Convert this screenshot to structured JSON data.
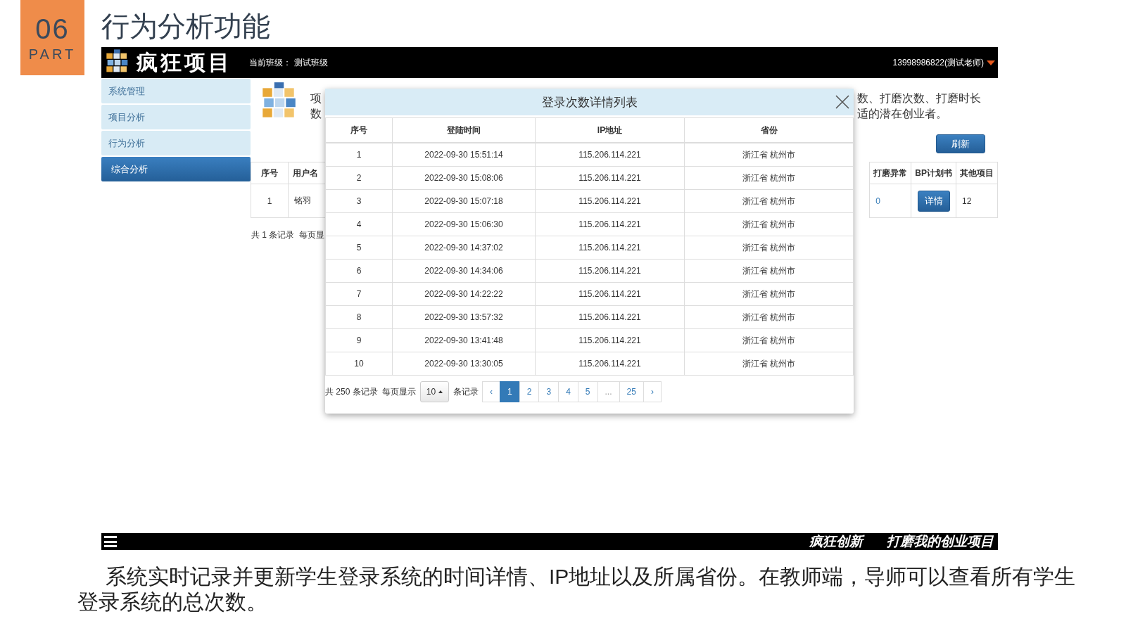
{
  "slide": {
    "part_number": "06",
    "part_label": "PART",
    "title": "行为分析功能"
  },
  "app": {
    "logo_text": "疯狂项目",
    "class_label": "当前班级：",
    "class_name": "测试班级",
    "user": "13998986822(测试老师)",
    "sidebar": [
      {
        "label": "系统管理",
        "selected": false
      },
      {
        "label": "项目分析",
        "selected": false
      },
      {
        "label": "行为分析",
        "selected": false
      },
      {
        "label": "综合分析",
        "selected": true
      }
    ],
    "intro_left": [
      "项",
      "数"
    ],
    "intro_right": [
      "数、打磨次数、打磨时长",
      "适的潜在创业者。"
    ],
    "refresh_button": "刷新",
    "table_left": {
      "columns": [
        "序号",
        "用户名"
      ],
      "rows": [
        [
          {
            "kind": "text",
            "text": "1"
          },
          {
            "kind": "text",
            "text": "铭羽"
          }
        ]
      ]
    },
    "table_right": {
      "columns": [
        "打磨异常",
        "BP计划书",
        "其他项目"
      ],
      "rows": [
        [
          {
            "kind": "link",
            "text": "0"
          },
          {
            "kind": "button",
            "text": "详情"
          },
          {
            "kind": "text",
            "text": "12"
          }
        ]
      ]
    },
    "pager_text": "共 1 条记录  每页显"
  },
  "modal": {
    "title": "登录次数详情列表",
    "columns": [
      "序号",
      "登陆时间",
      "IP地址",
      "省份"
    ],
    "rows": [
      [
        "1",
        "2022-09-30 15:51:14",
        "115.206.114.221",
        "浙江省 杭州市"
      ],
      [
        "2",
        "2022-09-30 15:08:06",
        "115.206.114.221",
        "浙江省 杭州市"
      ],
      [
        "3",
        "2022-09-30 15:07:18",
        "115.206.114.221",
        "浙江省 杭州市"
      ],
      [
        "4",
        "2022-09-30 15:06:30",
        "115.206.114.221",
        "浙江省 杭州市"
      ],
      [
        "5",
        "2022-09-30 14:37:02",
        "115.206.114.221",
        "浙江省 杭州市"
      ],
      [
        "6",
        "2022-09-30 14:34:06",
        "115.206.114.221",
        "浙江省 杭州市"
      ],
      [
        "7",
        "2022-09-30 14:22:22",
        "115.206.114.221",
        "浙江省 杭州市"
      ],
      [
        "8",
        "2022-09-30 13:57:32",
        "115.206.114.221",
        "浙江省 杭州市"
      ],
      [
        "9",
        "2022-09-30 13:41:48",
        "115.206.114.221",
        "浙江省 杭州市"
      ],
      [
        "10",
        "2022-09-30 13:30:05",
        "115.206.114.221",
        "浙江省 杭州市"
      ]
    ],
    "pagination": {
      "total": "共 250 条记录",
      "per_page_label": "每页显示",
      "per_page": "10",
      "per_page_suffix": "条记录",
      "prev": "‹",
      "next": "›",
      "pages": [
        {
          "label": "1",
          "selected": true,
          "kind": "page"
        },
        {
          "label": "2",
          "selected": false,
          "kind": "page"
        },
        {
          "label": "3",
          "selected": false,
          "kind": "page"
        },
        {
          "label": "4",
          "selected": false,
          "kind": "page"
        },
        {
          "label": "5",
          "selected": false,
          "kind": "page"
        },
        {
          "label": "...",
          "selected": false,
          "kind": "ellipsis"
        },
        {
          "label": "25",
          "selected": false,
          "kind": "page"
        }
      ]
    }
  },
  "footer_bar": {
    "slogans": [
      "疯狂创新",
      "打磨我的创业项目"
    ]
  },
  "caption": "系统实时记录并更新学生登录系统的时间详情、IP地址以及所属省份。在教师端，导师可以查看所有学生登录系统的总次数。"
}
